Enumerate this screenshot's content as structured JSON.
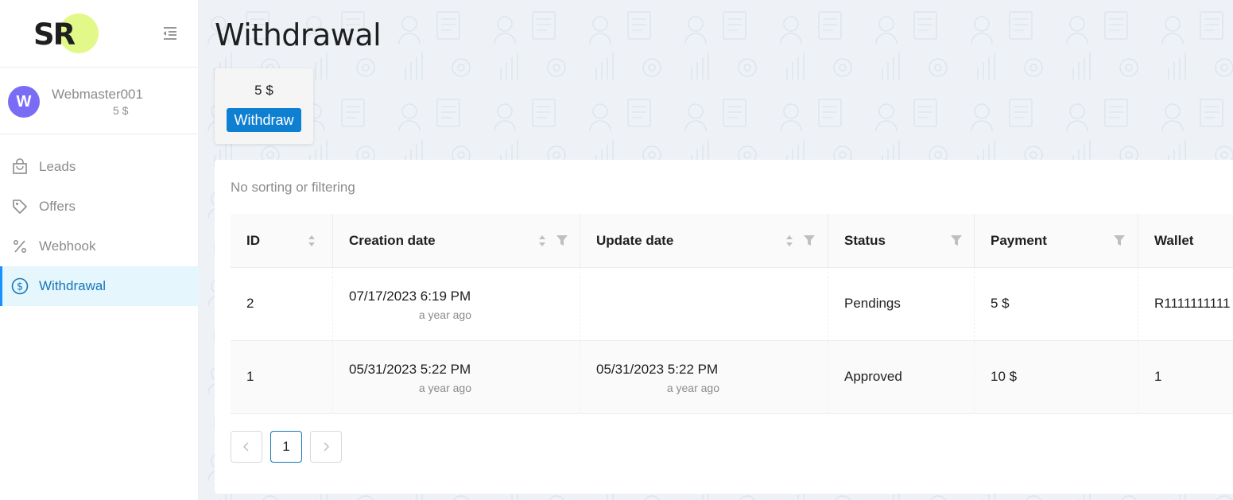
{
  "app": {
    "logo_text": "SR",
    "accent": "#1890ff",
    "logo_blob_color": "#e2f98a"
  },
  "user": {
    "avatar_letter": "W",
    "name": "Webmaster001",
    "balance": "5 $",
    "avatar_color": "#7b6cf6"
  },
  "sidebar": {
    "items": [
      {
        "label": "Leads",
        "icon": "shopping-bag-icon"
      },
      {
        "label": "Offers",
        "icon": "tag-icon"
      },
      {
        "label": "Webhook",
        "icon": "percent-icon"
      },
      {
        "label": "Withdrawal",
        "icon": "dollar-circle-icon",
        "active": true
      }
    ]
  },
  "page": {
    "title": "Withdrawal",
    "balance": "5 $",
    "withdraw_label": "Withdraw",
    "filter_note": "No sorting or filtering"
  },
  "table": {
    "columns": [
      {
        "label": "ID",
        "sortable": true,
        "filterable": false
      },
      {
        "label": "Creation date",
        "sortable": true,
        "filterable": true
      },
      {
        "label": "Update date",
        "sortable": true,
        "filterable": true
      },
      {
        "label": "Status",
        "sortable": false,
        "filterable": true
      },
      {
        "label": "Payment",
        "sortable": false,
        "filterable": true
      },
      {
        "label": "Wallet",
        "sortable": false,
        "filterable": false
      }
    ],
    "rows": [
      {
        "id": "2",
        "created": "07/17/2023 6:19 PM",
        "created_rel": "a year ago",
        "updated": "",
        "updated_rel": "",
        "status": "Pendings",
        "payment": "5 $",
        "wallet": "R1111111111"
      },
      {
        "id": "1",
        "created": "05/31/2023 5:22 PM",
        "created_rel": "a year ago",
        "updated": "05/31/2023 5:22 PM",
        "updated_rel": "a year ago",
        "status": "Approved",
        "payment": "10 $",
        "wallet": "1"
      }
    ]
  },
  "pagination": {
    "prev": "<",
    "current": "1",
    "next": ">"
  }
}
